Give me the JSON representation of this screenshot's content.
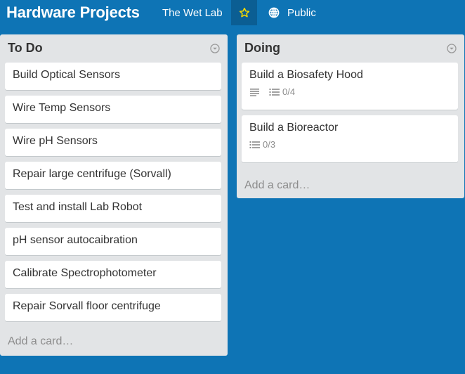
{
  "board": {
    "title": "Hardware Projects",
    "organization": "The Wet Lab",
    "visibility": "Public",
    "star_icon": "star-icon",
    "visibility_icon": "globe-icon"
  },
  "colors": {
    "background": "#0e74b5",
    "star_button_bg": "#0b5e93",
    "star": "#f2d600",
    "list_bg": "#e2e4e6"
  },
  "lists": [
    {
      "title": "To Do",
      "cards": [
        {
          "title": "Build Optical Sensors"
        },
        {
          "title": "Wire Temp Sensors"
        },
        {
          "title": "Wire pH Sensors"
        },
        {
          "title": "Repair large centrifuge (Sorvall)"
        },
        {
          "title": "Test and install Lab Robot"
        },
        {
          "title": "pH sensor autocaibration"
        },
        {
          "title": "Calibrate Spectrophotometer"
        },
        {
          "title": "Repair Sorvall floor centrifuge"
        }
      ],
      "add_card_label": "Add a card…"
    },
    {
      "title": "Doing",
      "cards": [
        {
          "title": "Build a Biosafety Hood",
          "has_description": true,
          "checklist": "0/4"
        },
        {
          "title": "Build a Bioreactor",
          "has_description": false,
          "checklist": "0/3"
        }
      ],
      "add_card_label": "Add a card…"
    }
  ]
}
